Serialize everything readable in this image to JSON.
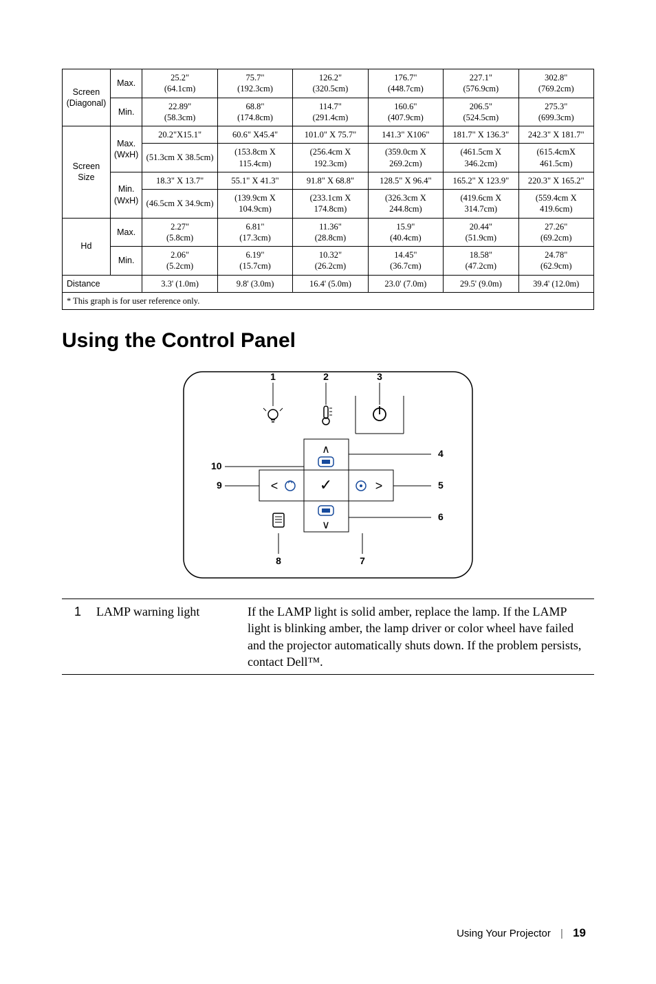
{
  "table": {
    "col_labels": {
      "screen_diag": "Screen\n(Diagonal)",
      "screen_size": "Screen\nSize",
      "hd": "Hd",
      "distance": "Distance"
    },
    "sub_labels": {
      "max": "Max.",
      "min": "Min.",
      "wxh": "(WxH)"
    },
    "rows": {
      "diag_max": [
        "25.2\"\n(64.1cm)",
        "75.7\"\n(192.3cm)",
        "126.2\"\n(320.5cm)",
        "176.7\"\n(448.7cm)",
        "227.1\"\n(576.9cm)",
        "302.8\"\n(769.2cm)"
      ],
      "diag_min": [
        "22.89\"\n(58.3cm)",
        "68.8\"\n(174.8cm)",
        "114.7\"\n(291.4cm)",
        "160.6\"\n(407.9cm)",
        "206.5\"\n(524.5cm)",
        "275.3\"\n(699.3cm)"
      ],
      "size_max_a": [
        "20.2\"X15.1\"",
        "60.6\" X45.4\"",
        "101.0\" X 75.7\"",
        "141.3\" X106\"",
        "181.7\" X 136.3\"",
        "242.3\" X 181.7\""
      ],
      "size_max_b": [
        "(51.3cm X 38.5cm)",
        "(153.8cm X 115.4cm)",
        "(256.4cm X 192.3cm)",
        "(359.0cm X 269.2cm)",
        "(461.5cm X 346.2cm)",
        "(615.4cmX 461.5cm)"
      ],
      "size_min_a": [
        "18.3\" X 13.7\"",
        "55.1\" X 41.3\"",
        "91.8\" X 68.8\"",
        "128.5\" X 96.4\"",
        "165.2\" X 123.9\"",
        "220.3\" X 165.2\""
      ],
      "size_min_b": [
        "(46.5cm X 34.9cm)",
        "(139.9cm X 104.9cm)",
        "(233.1cm X 174.8cm)",
        "(326.3cm X 244.8cm)",
        "(419.6cm X 314.7cm)",
        "(559.4cm X 419.6cm)"
      ],
      "hd_max": [
        "2.27\"\n(5.8cm)",
        "6.81\"\n(17.3cm)",
        "11.36\"\n(28.8cm)",
        "15.9\"\n(40.4cm)",
        "20.44\"\n(51.9cm)",
        "27.26\"\n(69.2cm)"
      ],
      "hd_min": [
        "2.06\"\n(5.2cm)",
        "6.19\"\n(15.7cm)",
        "10.32\"\n(26.2cm)",
        "14.45\"\n(36.7cm)",
        "18.58\"\n(47.2cm)",
        "24.78\"\n(62.9cm)"
      ],
      "distance": [
        "3.3' (1.0m)",
        "9.8' (3.0m)",
        "16.4' (5.0m)",
        "23.0' (7.0m)",
        "29.5' (9.0m)",
        "39.4' (12.0m)"
      ]
    },
    "footnote": "* This graph is for user reference only."
  },
  "heading": "Using the Control Panel",
  "diagram_labels": [
    "1",
    "2",
    "3",
    "4",
    "5",
    "6",
    "7",
    "8",
    "9",
    "10"
  ],
  "desc": {
    "num": "1",
    "label": "LAMP warning light",
    "text": "If the LAMP light is solid amber, replace the lamp. If the LAMP light is blinking amber, the lamp driver or color wheel have failed and the projector automatically shuts down. If the problem persists, contact Dell™."
  },
  "footer": {
    "section": "Using Your Projector",
    "page": "19"
  }
}
